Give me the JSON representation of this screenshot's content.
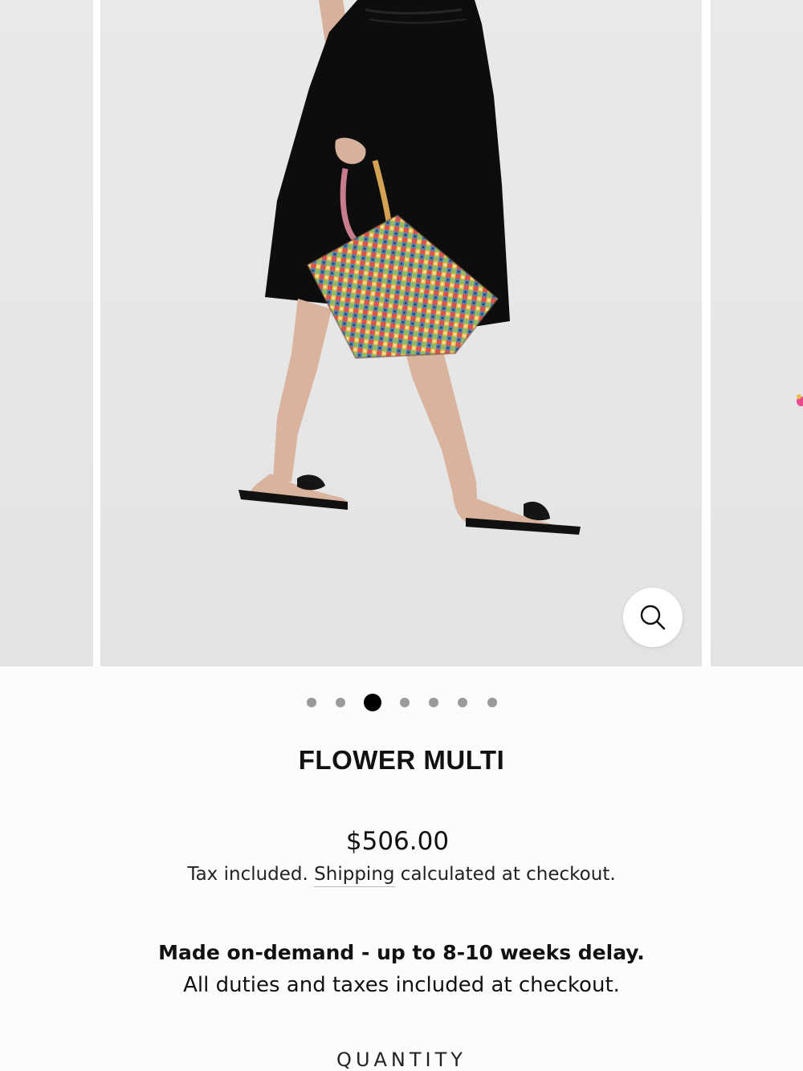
{
  "gallery": {
    "current_slide": 3,
    "total_slides": 7,
    "zoom_icon": "search-icon"
  },
  "product": {
    "title": "FLOWER MULTI",
    "price": "$506.00",
    "tax_prefix": "Tax included. ",
    "shipping_link": "Shipping",
    "tax_suffix": " calculated at checkout.",
    "delay_notice": "Made on-demand - up to 8-10 weeks delay.",
    "duties_notice": "All duties and taxes included at checkout.",
    "quantity_label": "QUANTITY"
  },
  "colors": {
    "background": "#fdfbfb",
    "dot_active": "#000000",
    "dot_inactive": "#9a9a9a"
  }
}
